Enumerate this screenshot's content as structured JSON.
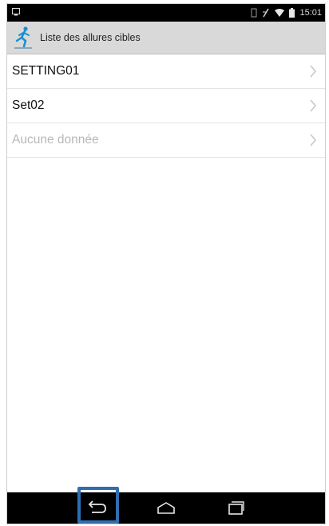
{
  "status_bar": {
    "time": "15:01",
    "icons": [
      "notification-icon",
      "battery-icon",
      "wifi-icon",
      "signal-icon",
      "screen-icon"
    ]
  },
  "header": {
    "title": "Liste des allures cibles",
    "logo_icon": "runner-logo-icon"
  },
  "list": {
    "items": [
      {
        "label": "SETTING01",
        "enabled": true
      },
      {
        "label": "Set02",
        "enabled": true
      },
      {
        "label": "Aucune donnée",
        "enabled": false
      }
    ]
  },
  "nav_bar": {
    "buttons": [
      "back-icon",
      "home-icon",
      "recent-apps-icon"
    ],
    "highlight_color": "#2f6fb0"
  }
}
